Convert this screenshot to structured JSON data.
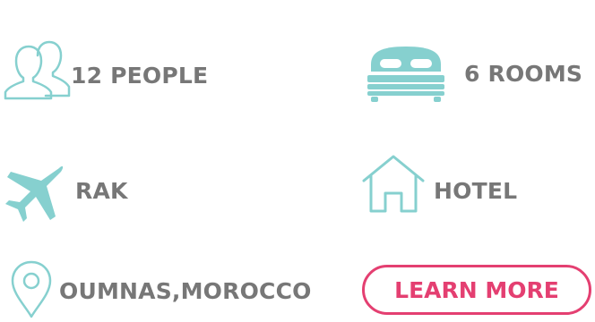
{
  "colors": {
    "accent_teal": "#86d0cf",
    "label_gray": "#777777",
    "button_pink": "#e43f71"
  },
  "details": {
    "people": {
      "icon": "people-icon",
      "label": "12 PEOPLE"
    },
    "rooms": {
      "icon": "bed-icon",
      "label": "6 ROOMS"
    },
    "airport": {
      "icon": "plane-icon",
      "label": "RAK"
    },
    "accommodation": {
      "icon": "house-icon",
      "label": "HOTEL"
    },
    "location": {
      "icon": "map-pin-icon",
      "label": "OUMNAS,MOROCCO"
    }
  },
  "cta": {
    "label": "LEARN MORE"
  }
}
